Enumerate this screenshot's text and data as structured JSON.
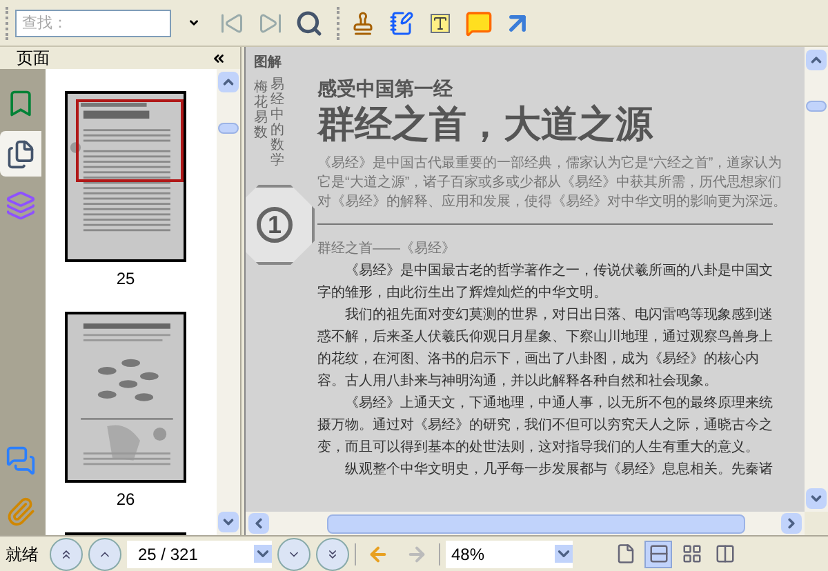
{
  "search": {
    "placeholder": "查找："
  },
  "panel": {
    "title": "页面",
    "tabs": [
      {
        "kind": "bookmarks",
        "selected": false
      },
      {
        "kind": "pages",
        "selected": true
      },
      {
        "kind": "layers",
        "selected": false
      },
      {
        "kind": "comments",
        "selected": false
      },
      {
        "kind": "attachments",
        "selected": false
      }
    ]
  },
  "thumbnails": [
    {
      "label": "25",
      "selected": true,
      "kind": "text"
    },
    {
      "label": "26",
      "selected": false,
      "kind": "diagram"
    }
  ],
  "document": {
    "side_title": "图解",
    "side_columns": [
      "梅花易数",
      "易经中的数学"
    ],
    "badge": "1",
    "kicker": "感受中国第一经",
    "title": "群经之首，大道之源",
    "intro": "《易经》是中国古代最重要的一部经典，儒家认为它是“六经之首”，道家认为它是“大道之源”，诸子百家或多或少都从《易经》中获其所需，历代思想家们对《易经》的解释、应用和发展，使得《易经》对中华文明的影响更为深远。",
    "section": "群经之首——《易经》",
    "paragraphs": [
      "《易经》是中国最古老的哲学著作之一，传说伏羲所画的八卦是中国文字的雏形，由此衍生出了辉煌灿烂的中华文明。",
      "我们的祖先面对变幻莫测的世界，对日出日落、电闪雷鸣等现象感到迷惑不解，后来圣人伏羲氏仰观日月星象、下察山川地理，通过观察鸟兽身上的花纹，在河图、洛书的启示下，画出了八卦图，成为《易经》的核心内容。古人用八卦来与神明沟通，并以此解释各种自然和社会现象。",
      "《易经》上通天文，下通地理，中通人事，以无所不包的最终原理来统摄万物。通过对《易经》的研究，我们不但可以穷究天人之际，通晓古今之变，而且可以得到基本的处世法则，这对指导我们的人生有重大的意义。",
      "纵观整个中华文明史，几乎每一步发展都与《易经》息息相关。先秦诸"
    ]
  },
  "status": {
    "text": "就绪",
    "page": "25 / 321",
    "zoom": "48%",
    "view_modes": [
      {
        "kind": "single",
        "selected": false
      },
      {
        "kind": "continuous",
        "selected": true
      },
      {
        "kind": "facing",
        "selected": false
      },
      {
        "kind": "continuous_facing",
        "selected": false
      }
    ]
  }
}
